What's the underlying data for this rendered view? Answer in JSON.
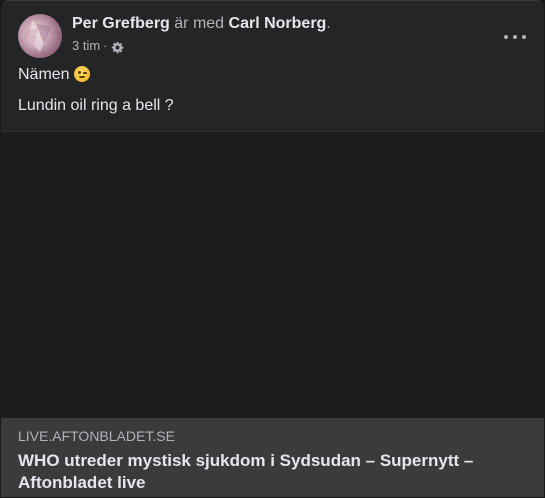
{
  "post": {
    "author": "Per Grefberg",
    "with_text": "är med",
    "tagged": "Carl Norberg",
    "period": ".",
    "time": "3 tim",
    "separator": "·",
    "privacy_icon": "gear-icon",
    "more_icon": "more-options-icon",
    "lines": [
      "Nämen",
      "Lundin oil ring a bell ?"
    ],
    "emoji": "winking-face"
  },
  "link_preview": {
    "domain": "LIVE.AFTONBLADET.SE",
    "headline": "WHO utreder mystisk sjukdom i Sydsudan – Supernytt – Aftonbladet live"
  }
}
